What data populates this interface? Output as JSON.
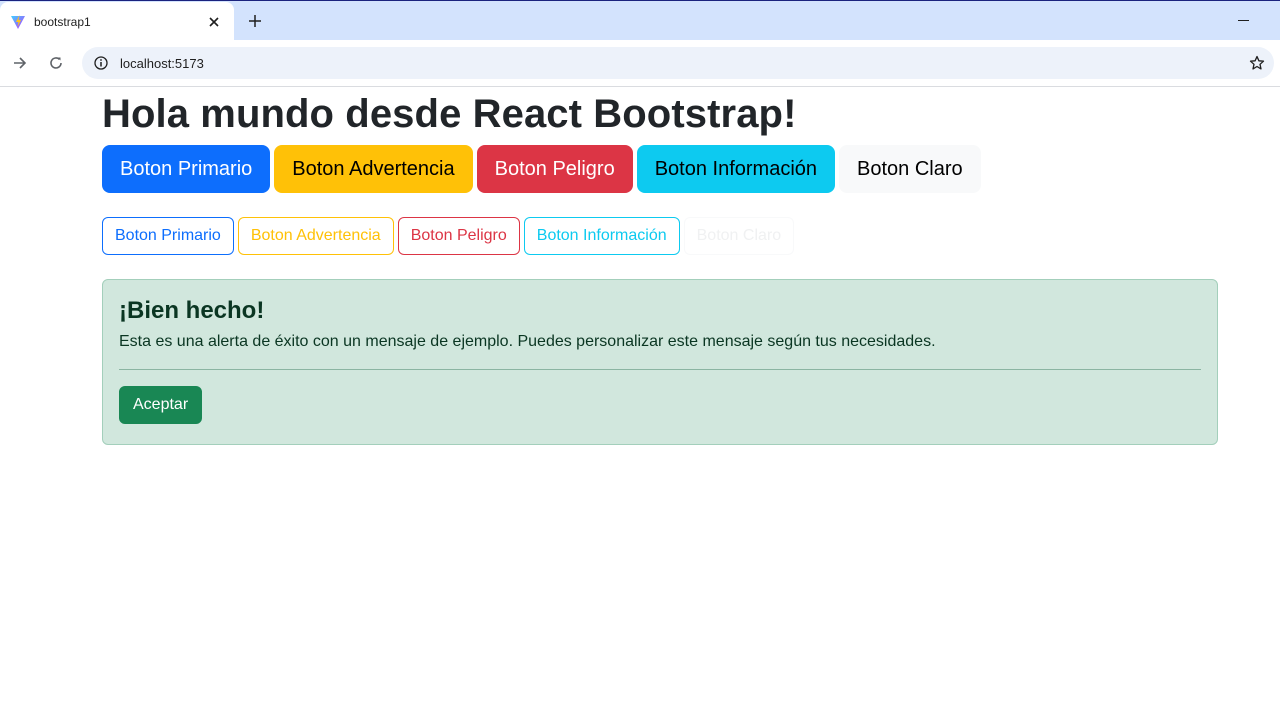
{
  "browser": {
    "tab_title": "bootstrap1",
    "url": "localhost:5173"
  },
  "page": {
    "heading": "Hola mundo desde React Bootstrap!",
    "solid_buttons": [
      {
        "label": "Boton Primario",
        "variant": "primary",
        "color": "#0d6efd"
      },
      {
        "label": "Boton Advertencia",
        "variant": "warning",
        "color": "#ffc107"
      },
      {
        "label": "Boton Peligro",
        "variant": "danger",
        "color": "#dc3545"
      },
      {
        "label": "Boton Información",
        "variant": "info",
        "color": "#0dcaf0"
      },
      {
        "label": "Boton Claro",
        "variant": "light",
        "color": "#f8f9fa"
      }
    ],
    "outline_buttons": [
      {
        "label": "Boton Primario",
        "variant": "outline-primary"
      },
      {
        "label": "Boton Advertencia",
        "variant": "outline-warning"
      },
      {
        "label": "Boton Peligro",
        "variant": "outline-danger"
      },
      {
        "label": "Boton Información",
        "variant": "outline-info"
      },
      {
        "label": "Boton Claro",
        "variant": "outline-light"
      }
    ],
    "alert": {
      "heading": "¡Bien hecho!",
      "text": "Esta es una alerta de éxito con un mensaje de ejemplo. Puedes personalizar este mensaje según tus necesidades.",
      "button_label": "Aceptar",
      "background": "#d1e7dd"
    }
  }
}
